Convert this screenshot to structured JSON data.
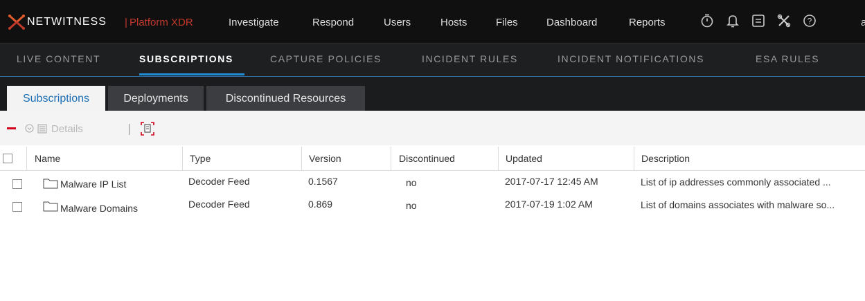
{
  "brand": {
    "name": "NETWITNESS",
    "separator": "|",
    "product": "Platform XDR"
  },
  "topnav": [
    "Investigate",
    "Respond",
    "Users",
    "Hosts",
    "Files",
    "Dashboard",
    "Reports"
  ],
  "topicons": [
    "stopwatch-icon",
    "bell-icon",
    "document-icon",
    "tools-icon",
    "help-icon"
  ],
  "user_initial": "a",
  "subnav": [
    "LIVE CONTENT",
    "SUBSCRIPTIONS",
    "CAPTURE POLICIES",
    "INCIDENT RULES",
    "INCIDENT NOTIFICATIONS",
    "ESA RULES"
  ],
  "subnav_active": "SUBSCRIPTIONS",
  "tabs": [
    "Subscriptions",
    "Deployments",
    "Discontinued Resources"
  ],
  "tab_active": "Subscriptions",
  "toolbar": {
    "details_label": "Details"
  },
  "table": {
    "columns": [
      "Name",
      "Type",
      "Version",
      "Discontinued",
      "Updated",
      "Description"
    ],
    "rows": [
      {
        "name": "Malware IP List",
        "type": "Decoder Feed",
        "version": "0.1567",
        "discontinued": "no",
        "updated": "2017-07-17 12:45 AM",
        "description": "List of ip addresses commonly associated ..."
      },
      {
        "name": "Malware Domains",
        "type": "Decoder Feed",
        "version": "0.869",
        "discontinued": "no",
        "updated": "2017-07-19 1:02 AM",
        "description": "List of domains associates with malware so..."
      }
    ]
  },
  "colors": {
    "accent": "#1e8fd6",
    "brand_red": "#c0392b",
    "delete_red": "#d0021b"
  }
}
